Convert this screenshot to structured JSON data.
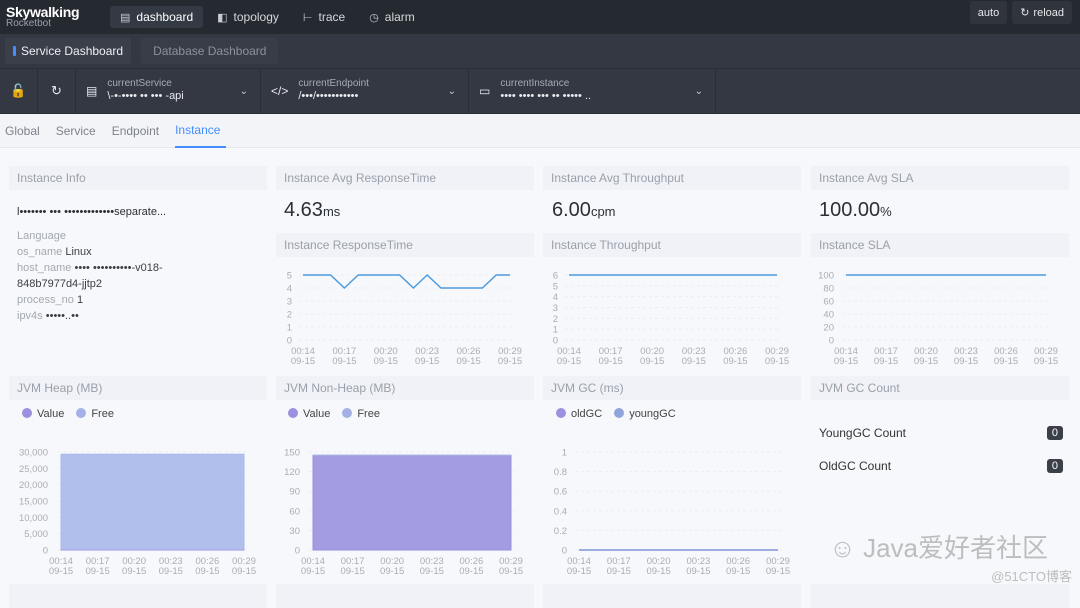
{
  "app": {
    "logo": "Skywalking",
    "logo_sub": "Rocketbot"
  },
  "nav": [
    {
      "label": "dashboard",
      "icon": "chart-icon",
      "active": true
    },
    {
      "label": "topology",
      "icon": "topology-icon",
      "active": false
    },
    {
      "label": "trace",
      "icon": "trace-icon",
      "active": false
    },
    {
      "label": "alarm",
      "icon": "alarm-icon",
      "active": false
    }
  ],
  "toolbar": {
    "auto_label": "auto",
    "reload_label": "reload"
  },
  "dashboards": {
    "service": "Service Dashboard",
    "database": "Database Dashboard"
  },
  "selectors": {
    "service": {
      "label": "currentService",
      "value": "\\-•-•••• •• ••• -api"
    },
    "endpoint": {
      "label": "currentEndpoint",
      "value": "/•••/•••••••••••"
    },
    "instance": {
      "label": "currentInstance",
      "value": "•••• •••• ••• •• ••••• .."
    }
  },
  "tabs": [
    "Global",
    "Service",
    "Endpoint",
    "Instance"
  ],
  "active_tab": "Instance",
  "instance_info": {
    "title": "Instance Info",
    "name": "l••••••• ••• •••••••••••••separate...",
    "language_label": "Language",
    "language_value": "",
    "os_name_label": "os_name",
    "os_name_value": "Linux",
    "host_name_label": "host_name",
    "host_name_value": "•••• ••••••••••-v018-",
    "host_name_value2": "848b7977d4-jjtp2",
    "process_no_label": "process_no",
    "process_no_value": "1",
    "ipv4s_label": "ipv4s",
    "ipv4s_value": "•••••..••"
  },
  "avg_cards": [
    {
      "title": "Instance Avg ResponseTime",
      "value": "4.63",
      "unit": "ms"
    },
    {
      "title": "Instance Avg Throughput",
      "value": "6.00",
      "unit": "cpm"
    },
    {
      "title": "Instance Avg SLA",
      "value": "100.00",
      "unit": "%"
    }
  ],
  "gc_count": {
    "title": "JVM GC Count",
    "rows": [
      {
        "label": "YoungGC Count",
        "value": "0"
      },
      {
        "label": "OldGC Count",
        "value": "0"
      }
    ]
  },
  "watermark": {
    "text": "Java爱好者社区",
    "sub": "@51CTO博客"
  },
  "chart_data": [
    {
      "id": "rt",
      "type": "line",
      "title": "Instance ResponseTime",
      "x": [
        "00:14",
        "00:15",
        "00:16",
        "00:17",
        "00:18",
        "00:19",
        "00:20",
        "00:21",
        "00:22",
        "00:23",
        "00:24",
        "00:25",
        "00:26",
        "00:27",
        "00:28",
        "00:29"
      ],
      "xticks": [
        [
          "00:14",
          "09-15"
        ],
        [
          "00:17",
          "09-15"
        ],
        [
          "00:20",
          "09-15"
        ],
        [
          "00:23",
          "09-15"
        ],
        [
          "00:26",
          "09-15"
        ],
        [
          "00:29",
          "09-15"
        ]
      ],
      "series": [
        {
          "name": "ResponseTime",
          "values": [
            5,
            5,
            5,
            4,
            5,
            5,
            5,
            5,
            4,
            5,
            4,
            4,
            4,
            4,
            5,
            5
          ],
          "color": "#4e9bdc"
        }
      ],
      "yticks": [
        0,
        1,
        2,
        3,
        4,
        5
      ],
      "ylim": [
        0,
        5
      ],
      "grid": true
    },
    {
      "id": "tp",
      "type": "line",
      "title": "Instance Throughput",
      "x": [
        "00:14",
        "00:15",
        "00:16",
        "00:17",
        "00:18",
        "00:19",
        "00:20",
        "00:21",
        "00:22",
        "00:23",
        "00:24",
        "00:25",
        "00:26",
        "00:27",
        "00:28",
        "00:29"
      ],
      "xticks": [
        [
          "00:14",
          "09-15"
        ],
        [
          "00:17",
          "09-15"
        ],
        [
          "00:20",
          "09-15"
        ],
        [
          "00:23",
          "09-15"
        ],
        [
          "00:26",
          "09-15"
        ],
        [
          "00:29",
          "09-15"
        ]
      ],
      "series": [
        {
          "name": "Throughput",
          "values": [
            6,
            6,
            6,
            6,
            6,
            6,
            6,
            6,
            6,
            6,
            6,
            6,
            6,
            6,
            6,
            6
          ],
          "color": "#4e9bdc"
        }
      ],
      "yticks": [
        0,
        1,
        2,
        3,
        4,
        5,
        6
      ],
      "ylim": [
        0,
        6
      ],
      "grid": true
    },
    {
      "id": "sla",
      "type": "line",
      "title": "Instance SLA",
      "x": [
        "00:14",
        "00:15",
        "00:16",
        "00:17",
        "00:18",
        "00:19",
        "00:20",
        "00:21",
        "00:22",
        "00:23",
        "00:24",
        "00:25",
        "00:26",
        "00:27",
        "00:28",
        "00:29"
      ],
      "xticks": [
        [
          "00:14",
          "09-15"
        ],
        [
          "00:17",
          "09-15"
        ],
        [
          "00:20",
          "09-15"
        ],
        [
          "00:23",
          "09-15"
        ],
        [
          "00:26",
          "09-15"
        ],
        [
          "00:29",
          "09-15"
        ]
      ],
      "series": [
        {
          "name": "SLA",
          "values": [
            100,
            100,
            100,
            100,
            100,
            100,
            100,
            100,
            100,
            100,
            100,
            100,
            100,
            100,
            100,
            100
          ],
          "color": "#4e9bdc"
        }
      ],
      "yticks": [
        0,
        20,
        40,
        60,
        80,
        100
      ],
      "ylim": [
        0,
        100
      ],
      "grid": true
    },
    {
      "id": "heap",
      "type": "area",
      "title": "JVM Heap (MB)",
      "x": [
        "00:14",
        "00:15",
        "00:16",
        "00:17",
        "00:18",
        "00:19",
        "00:20",
        "00:21",
        "00:22",
        "00:23",
        "00:24",
        "00:25",
        "00:26",
        "00:27",
        "00:28",
        "00:29"
      ],
      "xticks": [
        [
          "00:14",
          "09-15"
        ],
        [
          "00:17",
          "09-15"
        ],
        [
          "00:20",
          "09-15"
        ],
        [
          "00:23",
          "09-15"
        ],
        [
          "00:26",
          "09-15"
        ],
        [
          "00:29",
          "09-15"
        ]
      ],
      "stacked": true,
      "series": [
        {
          "name": "Value",
          "values": [
            200,
            200,
            200,
            200,
            200,
            200,
            200,
            200,
            200,
            200,
            200,
            200,
            200,
            200,
            200,
            200
          ],
          "color": "#9a91e0"
        },
        {
          "name": "Free",
          "values": [
            29100,
            29100,
            29100,
            29100,
            29100,
            29100,
            29100,
            29100,
            29100,
            29100,
            29100,
            29100,
            29100,
            29100,
            29100,
            29100
          ],
          "color": "#a9b8ea"
        }
      ],
      "yticks": [
        "0",
        "5,000",
        "10,000",
        "15,000",
        "20,000",
        "25,000",
        "30,000"
      ],
      "ylim": [
        0,
        30000
      ],
      "grid": true
    },
    {
      "id": "nonheap",
      "type": "area",
      "title": "JVM Non-Heap (MB)",
      "x": [
        "00:14",
        "00:15",
        "00:16",
        "00:17",
        "00:18",
        "00:19",
        "00:20",
        "00:21",
        "00:22",
        "00:23",
        "00:24",
        "00:25",
        "00:26",
        "00:27",
        "00:28",
        "00:29"
      ],
      "xticks": [
        [
          "00:14",
          "09-15"
        ],
        [
          "00:17",
          "09-15"
        ],
        [
          "00:20",
          "09-15"
        ],
        [
          "00:23",
          "09-15"
        ],
        [
          "00:26",
          "09-15"
        ],
        [
          "00:29",
          "09-15"
        ]
      ],
      "stacked": true,
      "series": [
        {
          "name": "Value",
          "values": [
            145,
            145,
            145,
            145,
            145,
            145,
            145,
            145,
            145,
            145,
            145,
            145,
            145,
            145,
            145,
            145
          ],
          "color": "#9a91e0"
        },
        {
          "name": "Free",
          "values": [
            0,
            0,
            0,
            0,
            0,
            0,
            0,
            0,
            0,
            0,
            0,
            0,
            0,
            0,
            0,
            0
          ],
          "color": "#a3b1e6"
        }
      ],
      "yticks": [
        "0",
        "30",
        "60",
        "90",
        "120",
        "150"
      ],
      "ylim": [
        0,
        150
      ],
      "grid": true
    },
    {
      "id": "gc",
      "type": "line",
      "title": "JVM GC (ms)",
      "x": [
        "00:14",
        "00:15",
        "00:16",
        "00:17",
        "00:18",
        "00:19",
        "00:20",
        "00:21",
        "00:22",
        "00:23",
        "00:24",
        "00:25",
        "00:26",
        "00:27",
        "00:28",
        "00:29"
      ],
      "xticks": [
        [
          "00:14",
          "09-15"
        ],
        [
          "00:17",
          "09-15"
        ],
        [
          "00:20",
          "09-15"
        ],
        [
          "00:23",
          "09-15"
        ],
        [
          "00:26",
          "09-15"
        ],
        [
          "00:29",
          "09-15"
        ]
      ],
      "series": [
        {
          "name": "oldGC",
          "values": [
            0,
            0,
            0,
            0,
            0,
            0,
            0,
            0,
            0,
            0,
            0,
            0,
            0,
            0,
            0,
            0
          ],
          "color": "#9a91e0"
        },
        {
          "name": "youngGC",
          "values": [
            0,
            0,
            0,
            0,
            0,
            0,
            0,
            0,
            0,
            0,
            0,
            0,
            0,
            0,
            0,
            0
          ],
          "color": "#8fa5dc"
        }
      ],
      "yticks": [
        "0",
        "0.2",
        "0.4",
        "0.6",
        "0.8",
        "1"
      ],
      "ylim": [
        0,
        1
      ],
      "grid": true
    }
  ]
}
